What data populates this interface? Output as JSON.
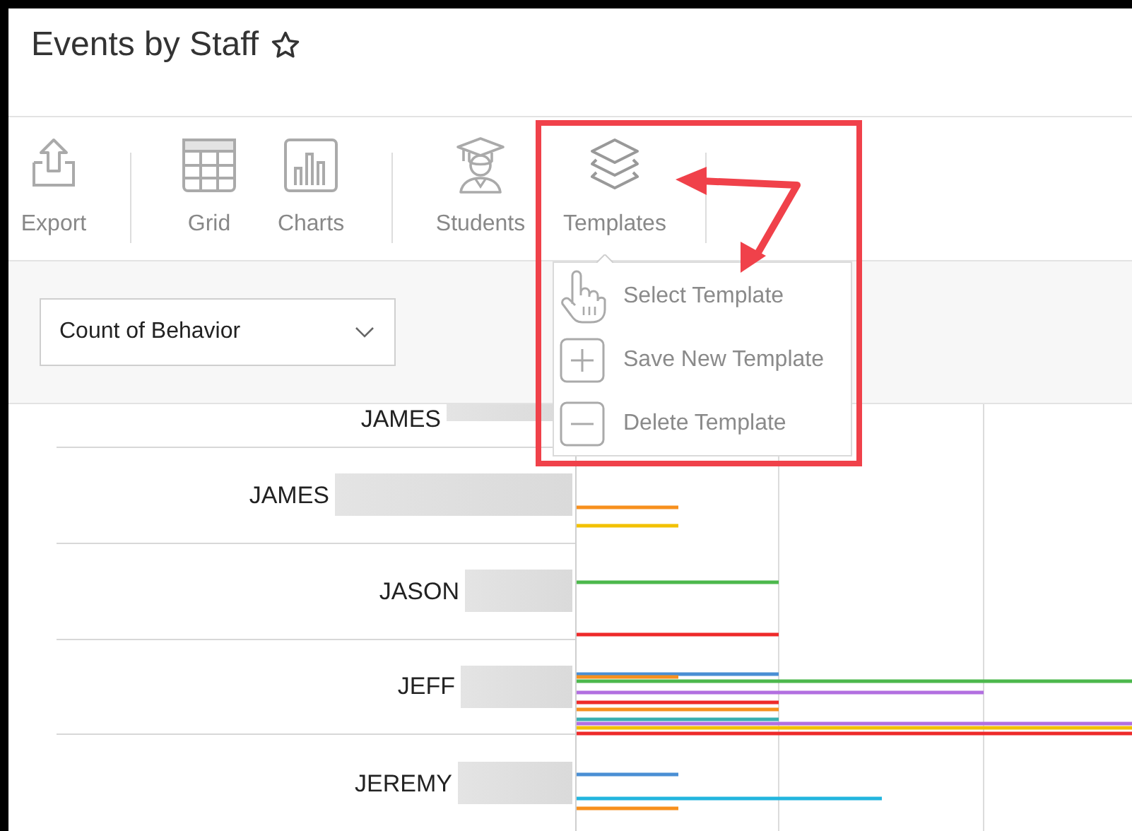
{
  "title": "Events by Staff",
  "favorite": false,
  "toolbar": [
    {
      "label": "Export",
      "kind": "export"
    },
    {
      "label": "Grid",
      "kind": "grid"
    },
    {
      "label": "Charts",
      "kind": "charts"
    },
    {
      "label": "Students",
      "kind": "students"
    },
    {
      "label": "Templates",
      "kind": "templates"
    }
  ],
  "measure_dropdown": {
    "value": "Count of Behavior"
  },
  "templates_menu": [
    {
      "label": "Select Template",
      "kind": "select"
    },
    {
      "label": "Save New Template",
      "kind": "add"
    },
    {
      "label": "Delete Template",
      "kind": "remove"
    }
  ],
  "staff_rows": [
    {
      "name": "JAMES"
    },
    {
      "name": "JAMES"
    },
    {
      "name": "JASON"
    },
    {
      "name": "JEFF"
    },
    {
      "name": "JEREMY"
    }
  ]
}
